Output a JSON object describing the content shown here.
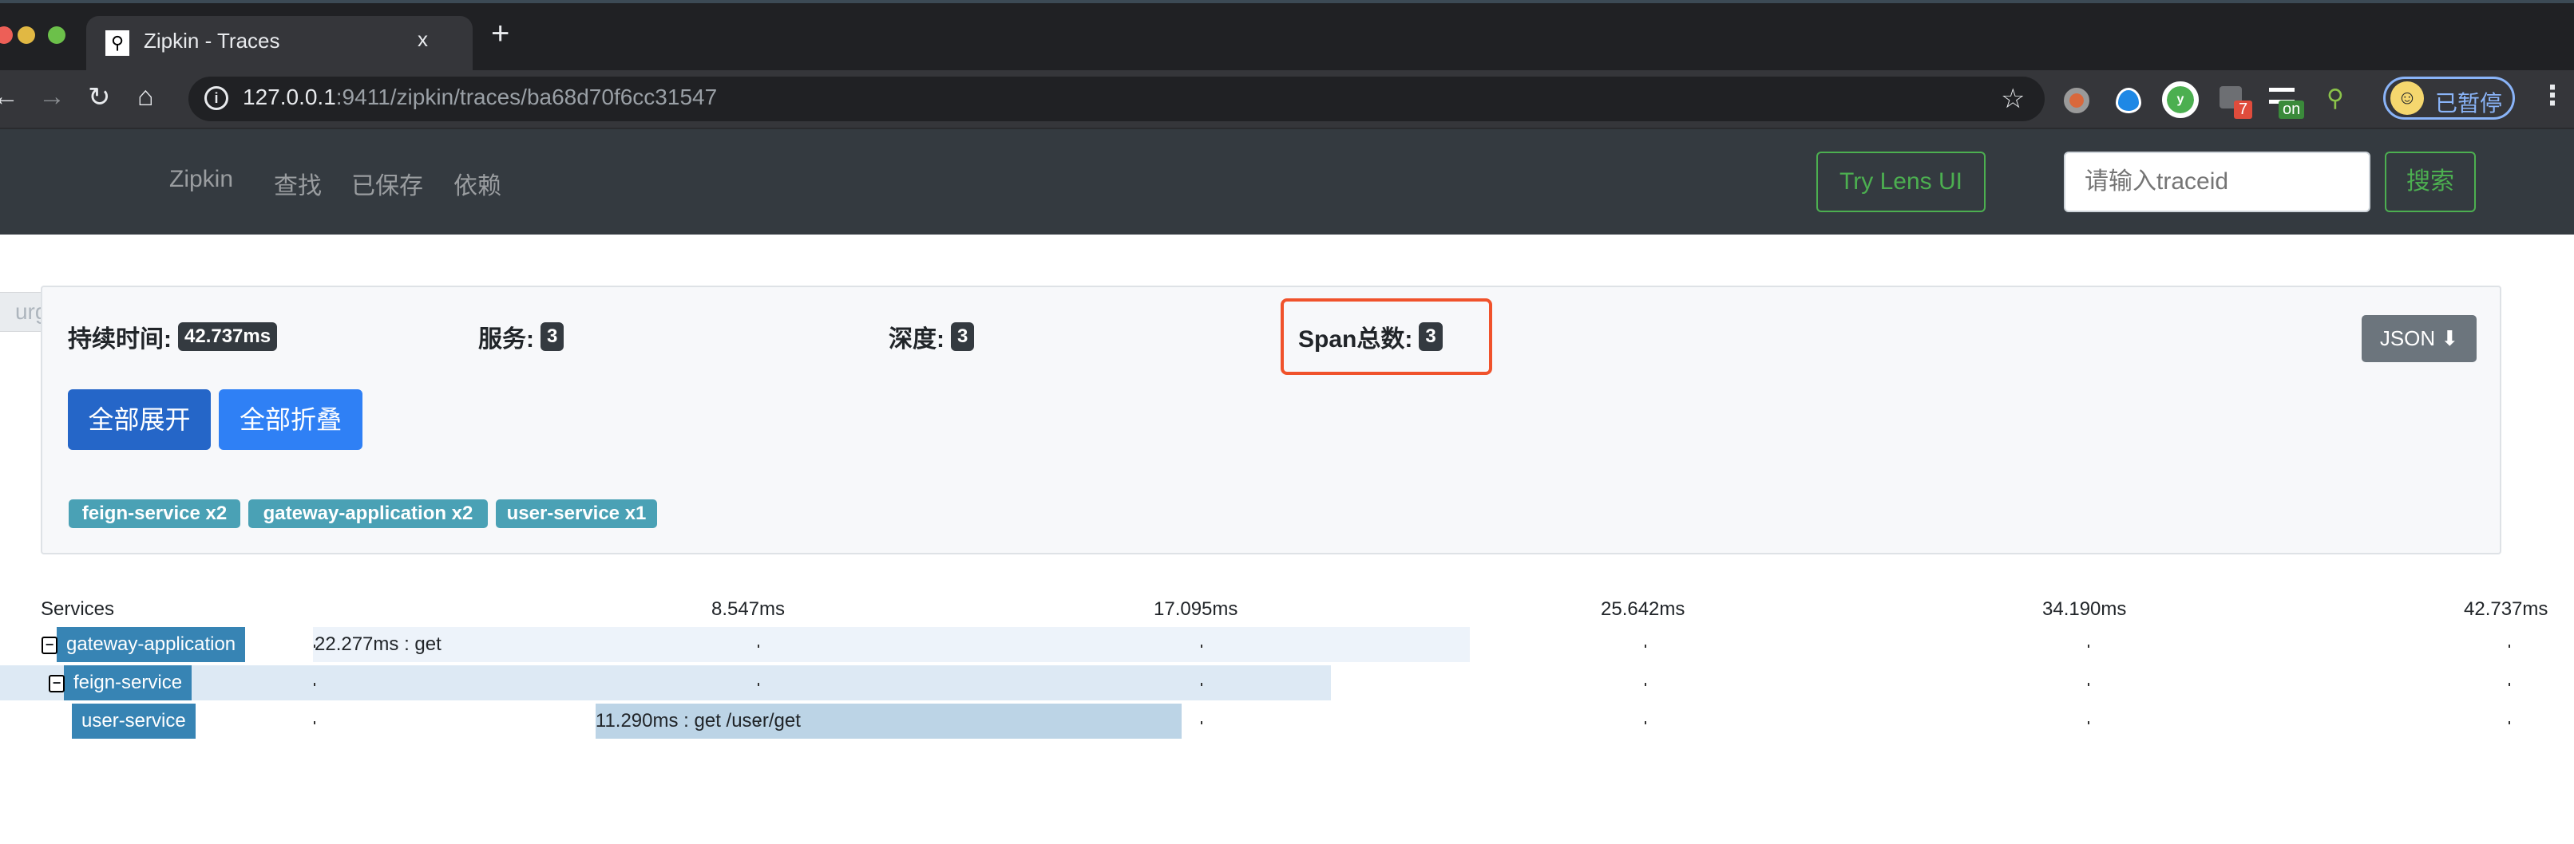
{
  "browser": {
    "tab_title": "Zipkin - Traces",
    "tab_close": "x",
    "new_tab": "+",
    "url_host": "127.0.0.1",
    "url_rest": ":9411/zipkin/traces/ba68d70f6cc31547",
    "profile_label": "已暂停",
    "extension_badges": [
      "7",
      "on"
    ]
  },
  "nav": {
    "brand": "Zipkin",
    "links": [
      "查找",
      "已保存",
      "依赖"
    ],
    "try_lens": "Try Lens UI",
    "search_placeholder": "请输入traceid",
    "search_button": "搜索"
  },
  "purge_label": "urge",
  "summary": {
    "duration_label": "持续时间:",
    "duration_value": "42.737ms",
    "services_label": "服务:",
    "services_value": "3",
    "depth_label": "深度:",
    "depth_value": "3",
    "spans_label": "Span总数:",
    "spans_value": "3",
    "json_button": "JSON",
    "expand_all": "全部展开",
    "collapse_all": "全部折叠",
    "service_tags": [
      "feign-service x2",
      "gateway-application x2",
      "user-service x1"
    ]
  },
  "timeline": {
    "services_header": "Services",
    "ticks": [
      "8.547ms",
      "17.095ms",
      "25.642ms",
      "34.190ms",
      "42.737ms"
    ],
    "total_ms": 42.737,
    "spans": [
      {
        "service": "gateway-application",
        "label": "22.277ms : get",
        "start_ms": 0,
        "duration_ms": 22.277,
        "depth": 0,
        "collapsible": true
      },
      {
        "service": "feign-service",
        "label": "",
        "start_ms": 0,
        "duration_ms": 19.6,
        "depth": 1,
        "collapsible": true,
        "highlighted": true
      },
      {
        "service": "user-service",
        "label": "11.290ms : get /user/get",
        "start_ms": 5.44,
        "duration_ms": 11.29,
        "depth": 2,
        "collapsible": false
      }
    ]
  },
  "colors": {
    "nav_bg": "#343a40",
    "accent_green": "#4caf50",
    "service_label": "#3784b4",
    "highlight_box": "#f0522b"
  }
}
